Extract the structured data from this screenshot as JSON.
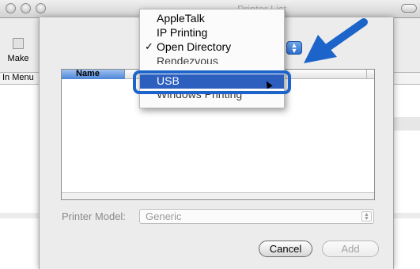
{
  "background_window": {
    "title": "Printer List",
    "toolbar_make_label": "Make",
    "list_header": "In Menu"
  },
  "connection_menu": {
    "items": [
      {
        "label": "AppleTalk",
        "checked": false
      },
      {
        "label": "IP Printing",
        "checked": false
      },
      {
        "label": "Open Directory",
        "checked": true,
        "check_mark": "✓"
      },
      {
        "label": "Rendezvous",
        "checked": false
      },
      {
        "label": "USB",
        "checked": false,
        "selected": true
      },
      {
        "label": "Windows Printing",
        "checked": false
      }
    ]
  },
  "sheet": {
    "table_header_name": "Name",
    "printer_model_label": "Printer Model:",
    "printer_model_value": "Generic",
    "cancel_label": "Cancel",
    "add_label": "Add"
  },
  "annotation": {
    "highlight_color": "#1c64c9",
    "arrow_color": "#1c64c9"
  }
}
